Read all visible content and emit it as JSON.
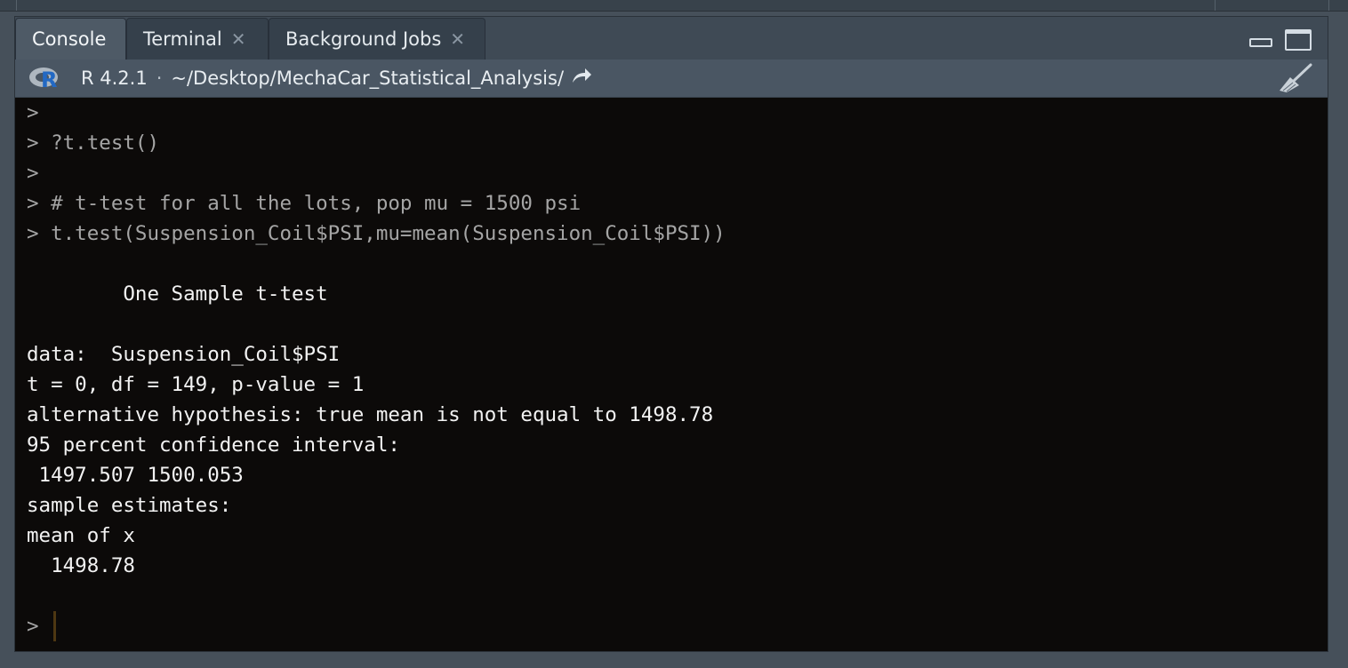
{
  "tabs": [
    {
      "label": "Console",
      "closable": false,
      "active": true
    },
    {
      "label": "Terminal",
      "closable": true,
      "active": false
    },
    {
      "label": "Background Jobs",
      "closable": true,
      "active": false
    }
  ],
  "infobar": {
    "r_version": "R 4.2.1",
    "separator": "·",
    "working_dir": "~/Desktop/MechaCar_Statistical_Analysis/"
  },
  "console": {
    "prompt": ">",
    "lines": [
      {
        "type": "input",
        "text": ""
      },
      {
        "type": "input",
        "text": "?t.test()"
      },
      {
        "type": "input",
        "text": ""
      },
      {
        "type": "input",
        "text": "# t-test for all the lots, pop mu = 1500 psi"
      },
      {
        "type": "input",
        "text": "t.test(Suspension_Coil$PSI,mu=mean(Suspension_Coil$PSI))"
      },
      {
        "type": "output",
        "text": ""
      },
      {
        "type": "output",
        "text": "        One Sample t-test"
      },
      {
        "type": "output",
        "text": ""
      },
      {
        "type": "output",
        "text": "data:  Suspension_Coil$PSI"
      },
      {
        "type": "output",
        "text": "t = 0, df = 149, p-value = 1"
      },
      {
        "type": "output",
        "text": "alternative hypothesis: true mean is not equal to 1498.78"
      },
      {
        "type": "output",
        "text": "95 percent confidence interval:"
      },
      {
        "type": "output",
        "text": " 1497.507 1500.053"
      },
      {
        "type": "output",
        "text": "sample estimates:"
      },
      {
        "type": "output",
        "text": "mean of x"
      },
      {
        "type": "output",
        "text": "  1498.78"
      },
      {
        "type": "output",
        "text": ""
      }
    ]
  },
  "colors": {
    "console_bg": "#0c0a09",
    "output_text": "#f2f2f2",
    "input_text": "#a5a5a5",
    "tab_active": "#4e5a66",
    "infobar_bg": "#4a5663",
    "cursor": "#4e3712"
  },
  "icons": {
    "r_logo": "r-logo-icon",
    "goto_dir": "arrow-right-icon",
    "clear_console": "broom-icon",
    "minimize": "minimize-icon",
    "maximize": "maximize-icon",
    "close_tab": "close-icon"
  }
}
